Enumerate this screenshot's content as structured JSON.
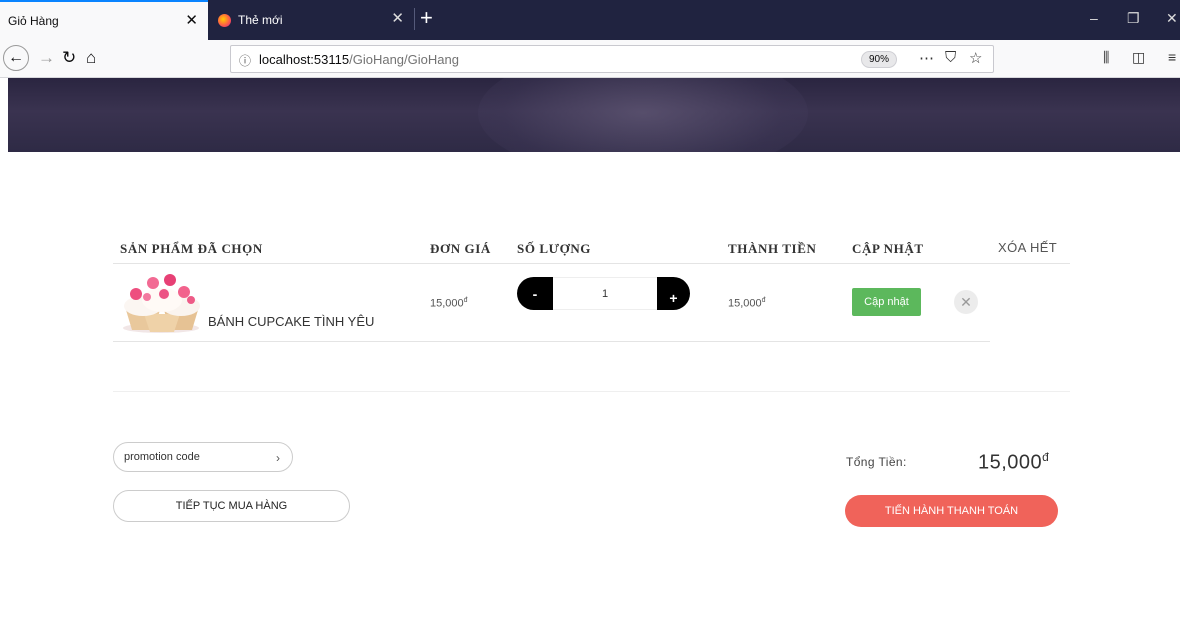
{
  "browser": {
    "tabs": [
      {
        "title": "Giỏ Hàng",
        "active": true
      },
      {
        "title": "Thẻ mới",
        "active": false
      }
    ],
    "url_host": "localhost:53115",
    "url_path": "/GioHang/GioHang",
    "zoom": "90%"
  },
  "table": {
    "headers": {
      "product": "SẢN PHẨM ĐÃ CHỌN",
      "unit_price": "ĐƠN GIÁ",
      "quantity": "SỐ LƯỢNG",
      "subtotal": "THÀNH TIỀN",
      "update": "CẬP NHẬT",
      "clear_all": "XÓA HẾT"
    },
    "items": [
      {
        "name": "BÁNH CUPCAKE TÌNH YÊU",
        "unit_price": "15,000",
        "currency": "đ",
        "quantity": "1",
        "subtotal": "15,000",
        "minus_label": "-",
        "plus_label": "+",
        "update_label": "Cập nhật"
      }
    ]
  },
  "footer": {
    "promo_placeholder": "promotion code",
    "continue_label": "TIẾP TỤC MUA HÀNG",
    "total_label": "Tổng Tiền:",
    "total_value": "15,000",
    "currency": "đ",
    "checkout_label": "TIẾN HÀNH THANH TOÁN"
  },
  "colors": {
    "update_button": "#5cb85c",
    "checkout_button": "#f0635a",
    "banner": "#2e2a45"
  }
}
